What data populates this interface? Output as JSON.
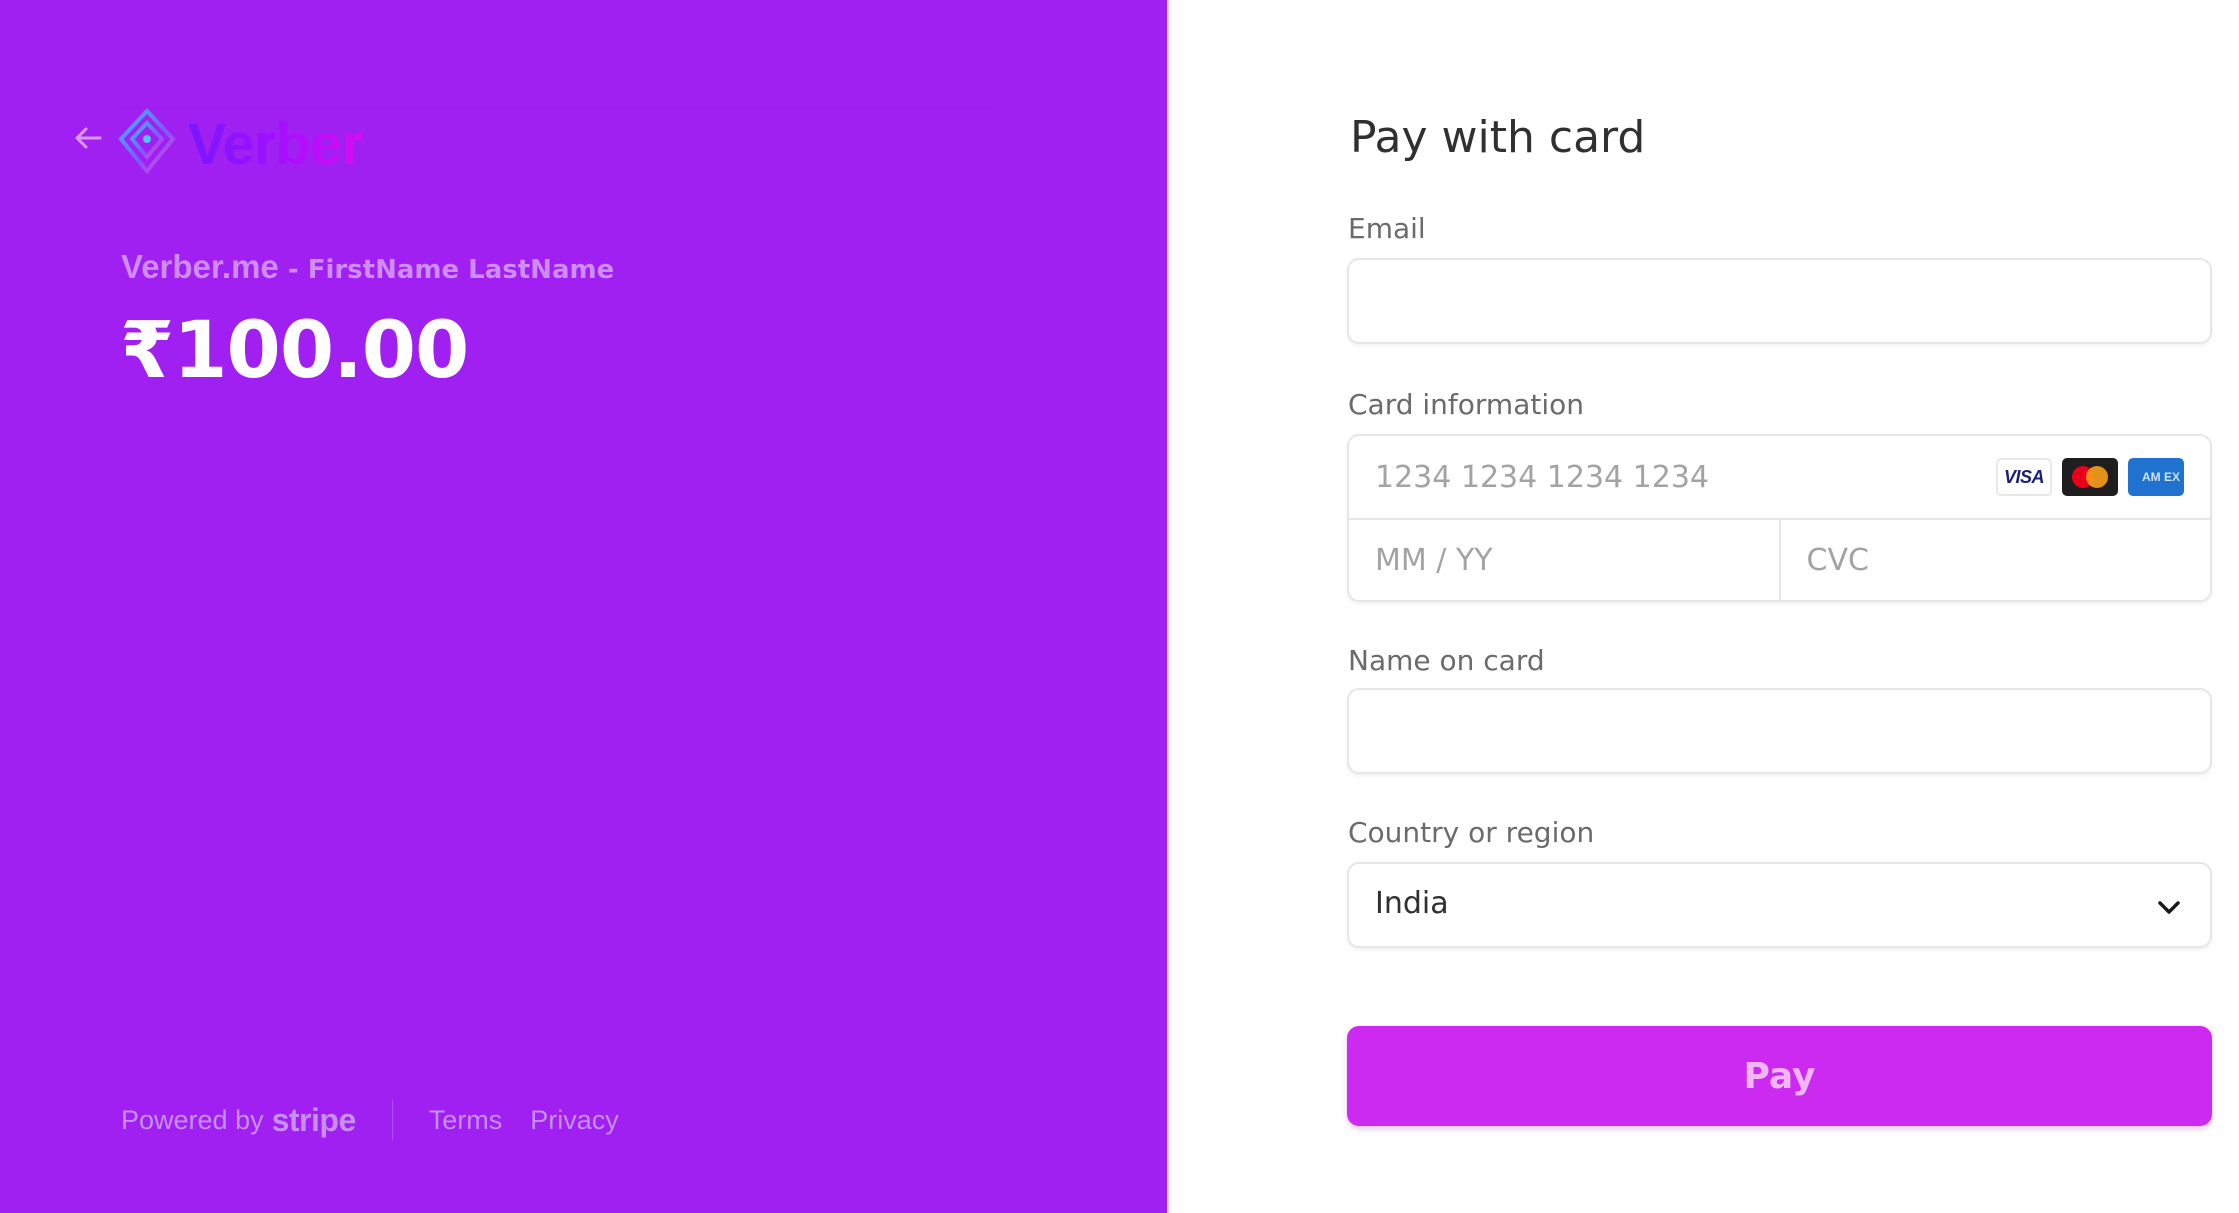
{
  "colors": {
    "left_panel_bg": "#a020f2",
    "pay_button_bg": "#cc2af0",
    "amount_text": "#ffffff",
    "merchant_text": "#cf8cf5"
  },
  "header": {
    "back_icon": "arrow-left-icon",
    "logo_icon": "verber-diamond-logo",
    "logo_text": "Verber"
  },
  "summary": {
    "merchant": "Verber.me",
    "separator": " - ",
    "customer": "FirstName LastName",
    "amount": "₹100.00"
  },
  "footer": {
    "powered_by": "Powered by",
    "stripe": "stripe",
    "links": [
      "Terms",
      "Privacy"
    ]
  },
  "form": {
    "title": "Pay with card",
    "email": {
      "label": "Email",
      "value": "",
      "placeholder": ""
    },
    "card": {
      "label": "Card information",
      "number_placeholder": "1234 1234 1234 1234",
      "expiry_placeholder": "MM / YY",
      "cvc_placeholder": "CVC",
      "brands": [
        "VISA",
        "Mastercard",
        "American Express"
      ],
      "visa_text": "VISA",
      "amex_text": "AM EX"
    },
    "name": {
      "label": "Name on card",
      "value": "",
      "placeholder": ""
    },
    "country": {
      "label": "Country or region",
      "selected": "India"
    },
    "pay_label": "Pay"
  }
}
